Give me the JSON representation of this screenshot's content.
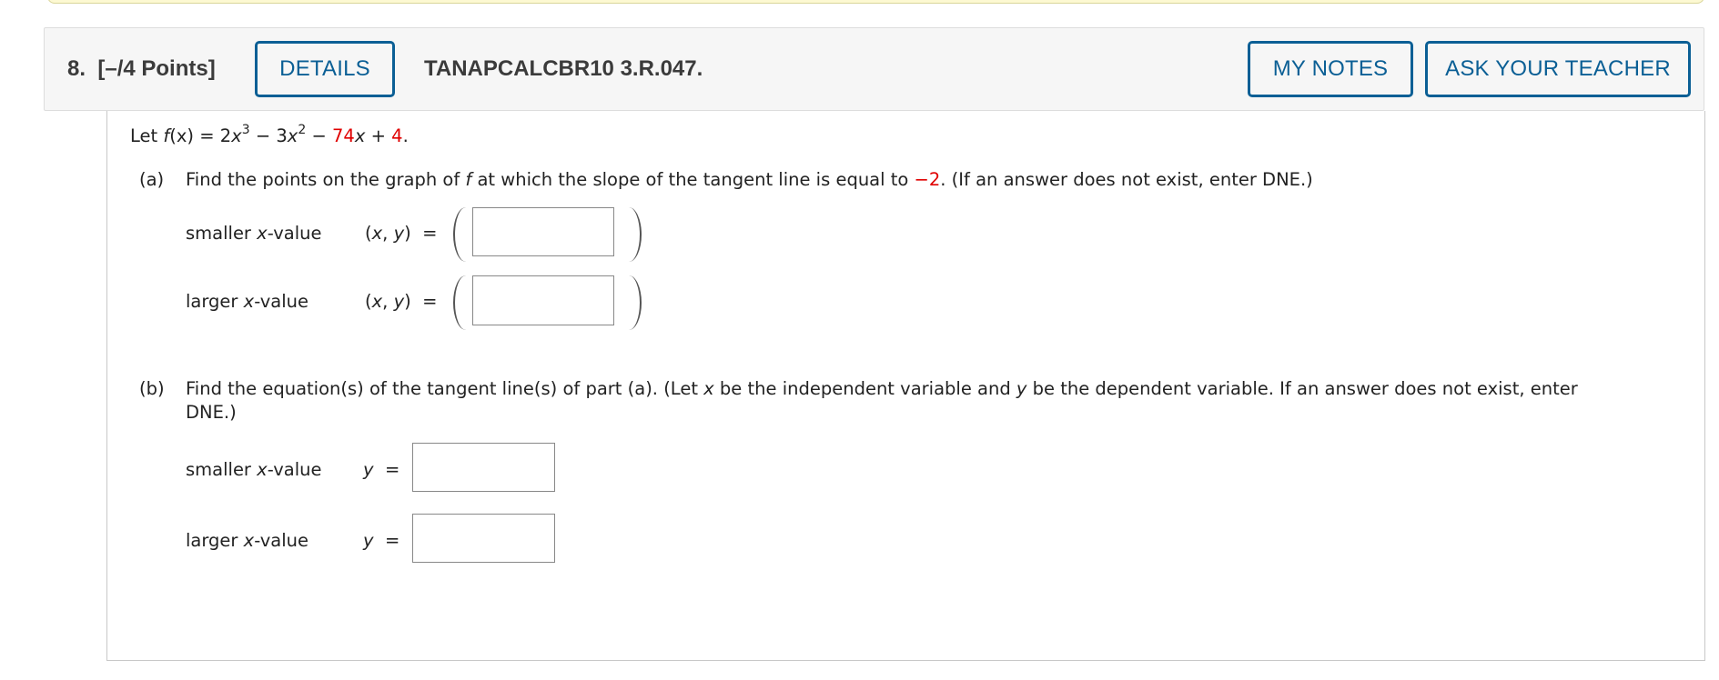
{
  "question": {
    "number": "8.",
    "points": "[–/4 Points]",
    "details_label": "DETAILS",
    "code": "TANAPCALCBR10 3.R.047.",
    "my_notes_label": "MY NOTES",
    "ask_teacher_label": "ASK YOUR TEACHER"
  },
  "colors": {
    "accent": "#0b5f95",
    "highlight": "#e00000",
    "banner": "#fdf9d2"
  },
  "problem": {
    "intro_prefix": "Let ",
    "func_name": "f",
    "func_arg": "(x)",
    "eq": " = 2",
    "x1": "x",
    "exp1": "3",
    "minus1": " − 3",
    "x2": "x",
    "exp2": "2",
    "minus2": " − ",
    "coef_red": "74",
    "x3": "x",
    "plus": " + ",
    "const_red": "4",
    "period": "."
  },
  "part_a": {
    "label": "(a)",
    "text_1": "Find the points on the graph of ",
    "text_f": "f",
    "text_2": " at which the slope of the tangent line is equal to ",
    "slope_red": "−2",
    "text_3": ". (If an answer does not exist, enter DNE.)",
    "rows": [
      {
        "label_pre": "smaller ",
        "label_x": "x",
        "label_post": "-value",
        "lhs_x": "x",
        "lhs_y": "y",
        "value": ""
      },
      {
        "label_pre": "larger ",
        "label_x": "x",
        "label_post": "-value",
        "lhs_x": "x",
        "lhs_y": "y",
        "value": ""
      }
    ]
  },
  "part_b": {
    "label": "(b)",
    "text_1": "Find the equation(s) of the tangent line(s) of part (a). (Let ",
    "text_x": "x",
    "text_2": " be the independent variable and ",
    "text_y": "y",
    "text_3": " be the dependent variable. If an answer does not exist, enter",
    "text_4": "DNE.)",
    "rows": [
      {
        "label_pre": "smaller ",
        "label_x": "x",
        "label_post": "-value",
        "lhs": "y",
        "value": ""
      },
      {
        "label_pre": "larger ",
        "label_x": "x",
        "label_post": "-value",
        "lhs": "y",
        "value": ""
      }
    ]
  }
}
